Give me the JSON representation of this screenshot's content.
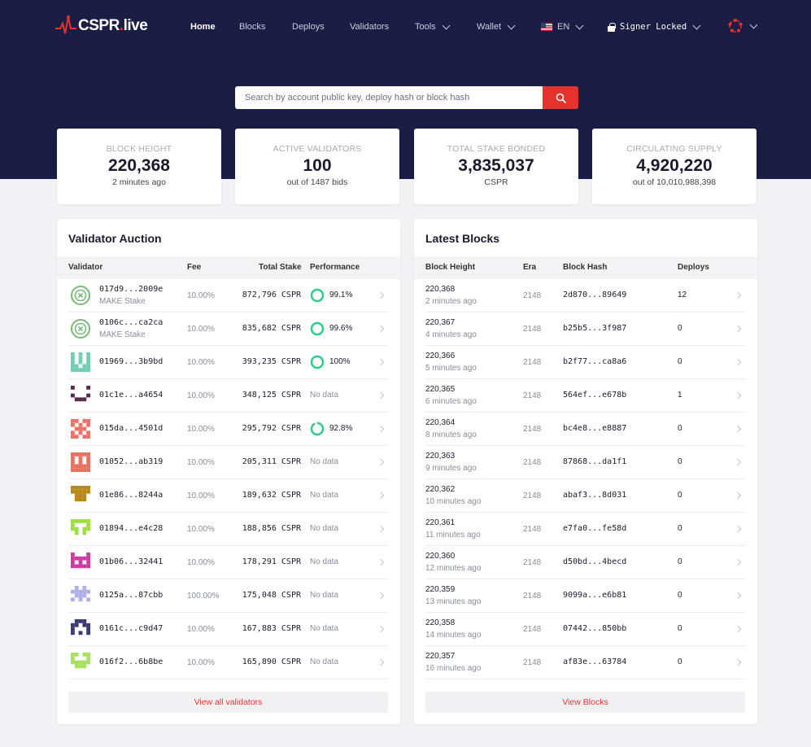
{
  "brand": {
    "name": "CSPR",
    "dot": ".",
    "suffix": "live",
    "accent": "#e5322d",
    "navy": "#1b1d45"
  },
  "nav": {
    "home": "Home",
    "blocks": "Blocks",
    "deploys": "Deploys",
    "validators": "Validators",
    "tools": "Tools",
    "wallet": "Wallet",
    "language": "EN",
    "signer": "Signer Locked"
  },
  "search": {
    "placeholder": "Search by account public key, deploy hash or block hash",
    "icon": "search-icon"
  },
  "stats": [
    {
      "label": "BLOCK HEIGHT",
      "value": "220,368",
      "sub": "2 minutes ago"
    },
    {
      "label": "ACTIVE VALIDATORS",
      "value": "100",
      "sub": "out of 1487 bids"
    },
    {
      "label": "TOTAL STAKE BONDED",
      "value": "3,835,037",
      "sub": "CSPR"
    },
    {
      "label": "CIRCULATING SUPPLY",
      "value": "4,920,220",
      "sub": "out of 10,010,988,398"
    }
  ],
  "auction": {
    "title": "Validator Auction",
    "headers": {
      "validator": "Validator",
      "fee": "Fee",
      "stake": "Total Stake",
      "performance": "Performance"
    },
    "rows": [
      {
        "hash": "017d9...2009e",
        "name": "MAKE Stake",
        "fee": "10.00%",
        "stake": "872,796 CSPR",
        "perf": "99.1%",
        "perf_value": 0.991,
        "avatar": "make",
        "color": "#7ab87a"
      },
      {
        "hash": "0106c...ca2ca",
        "name": "MAKE Stake",
        "fee": "10.00%",
        "stake": "835,682 CSPR",
        "perf": "99.6%",
        "perf_value": 0.996,
        "avatar": "make",
        "color": "#7ab87a"
      },
      {
        "hash": "01969...3b9bd",
        "name": "",
        "fee": "10.00%",
        "stake": "393,235 CSPR",
        "perf": "100%",
        "perf_value": 1.0,
        "avatar": "pix1",
        "color": "#6fcfb0"
      },
      {
        "hash": "01c1e...a4654",
        "name": "",
        "fee": "10.00%",
        "stake": "348,125 CSPR",
        "perf": "No data",
        "perf_value": null,
        "avatar": "pix2",
        "color": "#5a2a4a"
      },
      {
        "hash": "015da...4501d",
        "name": "",
        "fee": "10.00%",
        "stake": "295,792 CSPR",
        "perf": "92.8%",
        "perf_value": 0.928,
        "avatar": "pix3",
        "color": "#f07065"
      },
      {
        "hash": "01052...ab319",
        "name": "",
        "fee": "10.00%",
        "stake": "205,311 CSPR",
        "perf": "No data",
        "perf_value": null,
        "avatar": "pix4",
        "color": "#e8705f"
      },
      {
        "hash": "01e86...8244a",
        "name": "",
        "fee": "10.00%",
        "stake": "189,632 CSPR",
        "perf": "No data",
        "perf_value": null,
        "avatar": "pix5",
        "color": "#b8871a"
      },
      {
        "hash": "01894...e4c28",
        "name": "",
        "fee": "10.00%",
        "stake": "188,856 CSPR",
        "perf": "No data",
        "perf_value": null,
        "avatar": "pix6",
        "color": "#9ce040"
      },
      {
        "hash": "01b06...32441",
        "name": "",
        "fee": "10.00%",
        "stake": "178,291 CSPR",
        "perf": "No data",
        "perf_value": null,
        "avatar": "pix7",
        "color": "#cc3aa0"
      },
      {
        "hash": "0125a...87cbb",
        "name": "",
        "fee": "100.00%",
        "stake": "175,048 CSPR",
        "perf": "No data",
        "perf_value": null,
        "avatar": "pix8",
        "color": "#b0b0e8"
      },
      {
        "hash": "0161c...c9d47",
        "name": "",
        "fee": "10.00%",
        "stake": "167,883 CSPR",
        "perf": "No data",
        "perf_value": null,
        "avatar": "pix9",
        "color": "#3a3a78"
      },
      {
        "hash": "016f2...6b8be",
        "name": "",
        "fee": "10.00%",
        "stake": "165,890 CSPR",
        "perf": "No data",
        "perf_value": null,
        "avatar": "pix10",
        "color": "#a8e060"
      }
    ],
    "view_all": "View all validators"
  },
  "blocks": {
    "title": "Latest Blocks",
    "headers": {
      "height": "Block Height",
      "era": "Era",
      "hash": "Block Hash",
      "deploys": "Deploys"
    },
    "rows": [
      {
        "height": "220,368",
        "ago": "2 minutes ago",
        "era": "2148",
        "hash": "2d870...89649",
        "deploys": "12"
      },
      {
        "height": "220,367",
        "ago": "4 minutes ago",
        "era": "2148",
        "hash": "b25b5...3f987",
        "deploys": "0"
      },
      {
        "height": "220,366",
        "ago": "5 minutes ago",
        "era": "2148",
        "hash": "b2f77...ca8a6",
        "deploys": "0"
      },
      {
        "height": "220,365",
        "ago": "6 minutes ago",
        "era": "2148",
        "hash": "564ef...e678b",
        "deploys": "1"
      },
      {
        "height": "220,364",
        "ago": "8 minutes ago",
        "era": "2148",
        "hash": "bc4e8...e8887",
        "deploys": "0"
      },
      {
        "height": "220,363",
        "ago": "9 minutes ago",
        "era": "2148",
        "hash": "87868...da1f1",
        "deploys": "0"
      },
      {
        "height": "220,362",
        "ago": "10 minutes ago",
        "era": "2148",
        "hash": "abaf3...8d031",
        "deploys": "0"
      },
      {
        "height": "220,361",
        "ago": "11 minutes ago",
        "era": "2148",
        "hash": "e7fa0...fe58d",
        "deploys": "0"
      },
      {
        "height": "220,360",
        "ago": "12 minutes ago",
        "era": "2148",
        "hash": "d50bd...4becd",
        "deploys": "0"
      },
      {
        "height": "220,359",
        "ago": "13 minutes ago",
        "era": "2148",
        "hash": "9099a...e6b81",
        "deploys": "0"
      },
      {
        "height": "220,358",
        "ago": "14 minutes ago",
        "era": "2148",
        "hash": "07442...850bb",
        "deploys": "0"
      },
      {
        "height": "220,357",
        "ago": "16 minutes ago",
        "era": "2148",
        "hash": "af83e...63784",
        "deploys": "0"
      }
    ],
    "view_all": "View Blocks"
  }
}
